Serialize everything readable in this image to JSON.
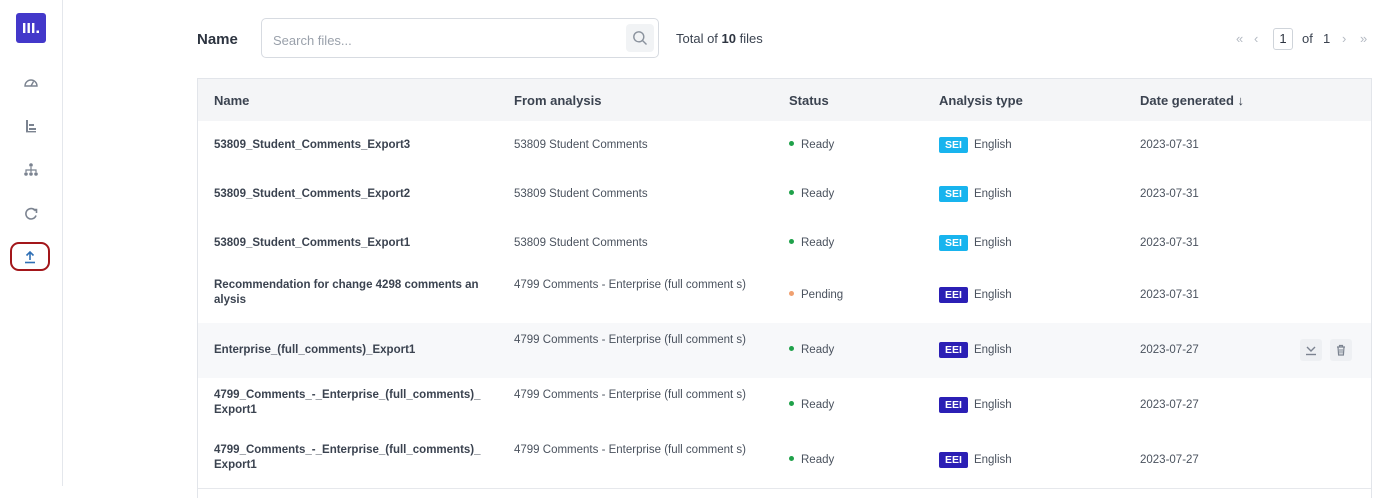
{
  "sidebar": {
    "logo_text": "III.",
    "items": [
      {
        "name": "dashboard-gauge-icon"
      },
      {
        "name": "bar-chart-icon"
      },
      {
        "name": "hierarchy-icon"
      },
      {
        "name": "refresh-cycle-icon"
      },
      {
        "name": "upload-icon",
        "active": true
      }
    ]
  },
  "toolbar": {
    "name_label": "Name",
    "search_placeholder": "Search files...",
    "total_prefix": "Total of ",
    "total_count": "10",
    "total_suffix": " files"
  },
  "pagination": {
    "first_icon": "«",
    "prev_icon": "‹",
    "current_page": "1",
    "of_label": "of",
    "total_pages": "1",
    "next_icon": "›",
    "last_icon": "»"
  },
  "table": {
    "columns": [
      "Name",
      "From analysis",
      "Status",
      "Analysis type",
      "Date generated"
    ],
    "sort_icon": "↓",
    "rows": [
      {
        "name": "53809_Student_Comments_Export3",
        "from": "53809 Student Comments",
        "status": "Ready",
        "tag": "SEI",
        "language": "English",
        "date": "2023-07-31"
      },
      {
        "name": "53809_Student_Comments_Export2",
        "from": "53809 Student Comments",
        "status": "Ready",
        "tag": "SEI",
        "language": "English",
        "date": "2023-07-31"
      },
      {
        "name": "53809_Student_Comments_Export1",
        "from": "53809 Student Comments",
        "status": "Ready",
        "tag": "SEI",
        "language": "English",
        "date": "2023-07-31"
      },
      {
        "name": "Recommendation for change 4298 comments an alysis",
        "from": "4799 Comments - Enterprise (full comment s)",
        "status": "Pending",
        "tag": "EEI",
        "language": "English",
        "date": "2023-07-31"
      },
      {
        "name": "Enterprise_(full_comments)_Export1",
        "from": "4799 Comments - Enterprise (full comment s)",
        "status": "Ready",
        "tag": "EEI",
        "language": "English",
        "date": "2023-07-27"
      },
      {
        "name": "4799_Comments_-_Enterprise_(full_comments)_ Export1",
        "from": "4799 Comments - Enterprise (full comment s)",
        "status": "Ready",
        "tag": "EEI",
        "language": "English",
        "date": "2023-07-27"
      },
      {
        "name": "4799_Comments_-_Enterprise_(full_comments)_ Export1",
        "from": "4799 Comments - Enterprise (full comment s)",
        "status": "Ready",
        "tag": "EEI",
        "language": "English",
        "date": "2023-07-27"
      }
    ]
  },
  "colors": {
    "brand": "#4338ca",
    "ready": "#1fa14a",
    "pending": "#f0a070",
    "tag_sei": "#18b4ee",
    "tag_eei": "#2b1fb5",
    "active_outline": "#a3161a"
  }
}
